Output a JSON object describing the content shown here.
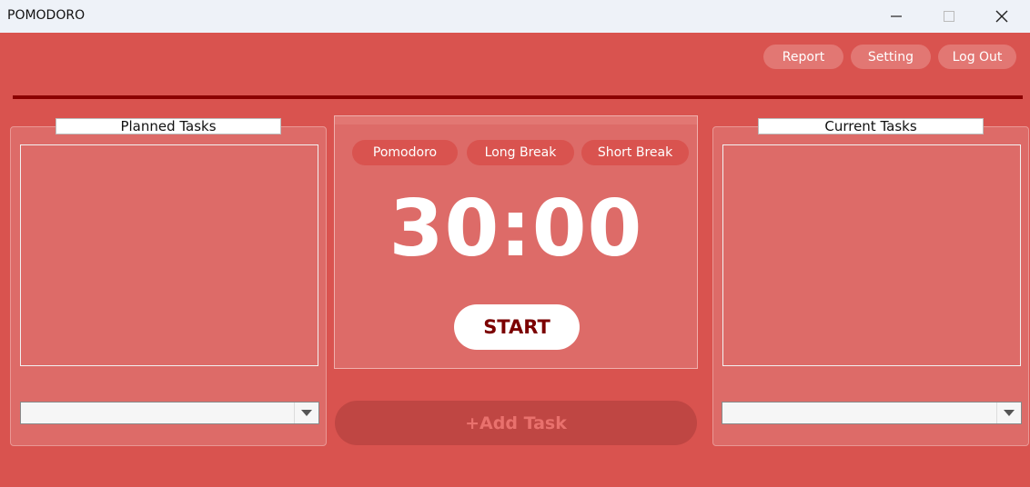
{
  "window": {
    "title": "POMODORO"
  },
  "nav": {
    "report": "Report",
    "setting": "Setting",
    "logout": "Log Out"
  },
  "planned": {
    "title": "Planned Tasks"
  },
  "current": {
    "title": "Current Tasks"
  },
  "timer": {
    "modes": [
      "Pomodoro",
      "Long Break",
      "Short Break"
    ],
    "display": "30:00",
    "start": "START"
  },
  "add_task": "+Add Task",
  "colors": {
    "background": "#d9534f",
    "accent_dark": "#8b0000",
    "panel": "#dd6b68"
  }
}
